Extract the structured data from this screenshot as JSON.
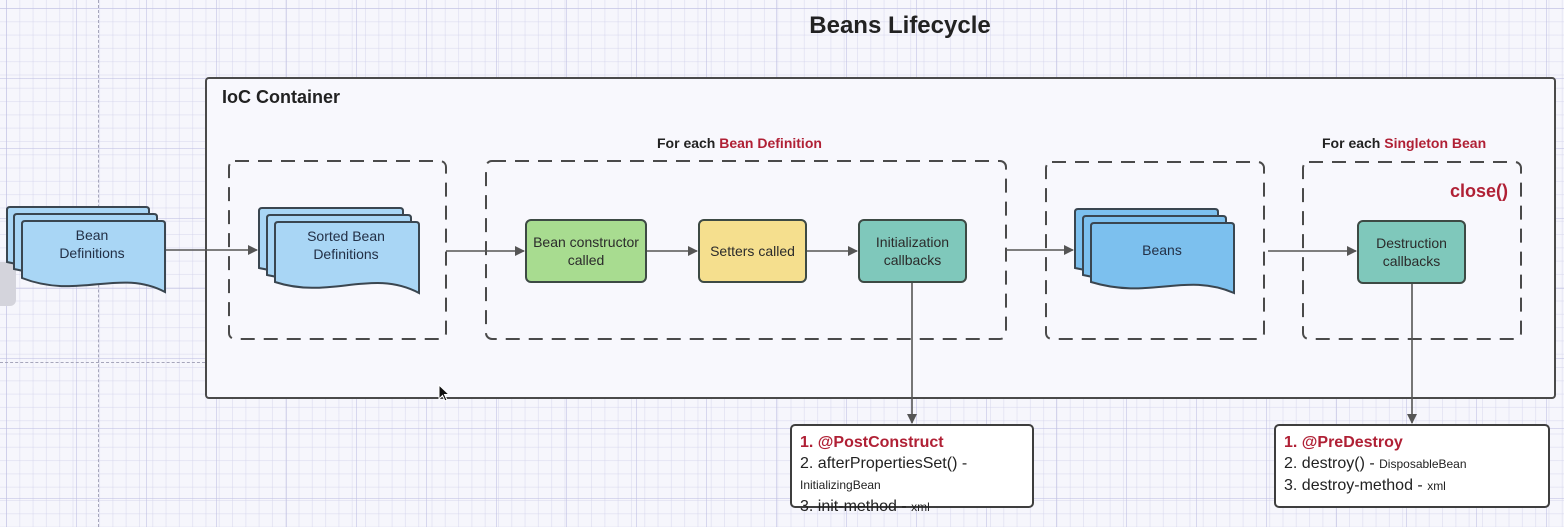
{
  "title": "Beans Lifecycle",
  "container": {
    "label": "IoC Container"
  },
  "sections": {
    "bean_definition_loop": {
      "prefix": "For each",
      "accent": "Bean Definition"
    },
    "singleton_loop": {
      "prefix": "For each",
      "accent": "Singleton Bean"
    },
    "close_label": "close()"
  },
  "nodes": {
    "bean_definitions": "Bean\nDefinitions",
    "sorted_bean_definitions": "Sorted Bean\nDefinitions",
    "bean_constructor": "Bean constructor\ncalled",
    "setters": "Setters called",
    "init_callbacks": "Initialization\ncallbacks",
    "beans": "Beans",
    "destruction_callbacks": "Destruction\ncallbacks"
  },
  "init_callbacks_list": [
    {
      "num": "1.",
      "text": "@PostConstruct",
      "note": ""
    },
    {
      "num": "2.",
      "text": "afterPropertiesSet()",
      "note": " - ",
      "small": "InitializingBean"
    },
    {
      "num": "3.",
      "text": "init-method",
      "note": " - ",
      "small": "xml"
    }
  ],
  "destroy_callbacks_list": [
    {
      "num": "1.",
      "text": "@PreDestroy",
      "note": ""
    },
    {
      "num": "2.",
      "text": "destroy()",
      "note": " - ",
      "small": "DisposableBean"
    },
    {
      "num": "3.",
      "text": "destroy-method",
      "note": " - ",
      "small": "xml"
    }
  ],
  "colors": {
    "accent": "#b02035",
    "doc_light": "#a9d6f5",
    "doc_mid": "#7cc0ee",
    "green": "#a8dc90",
    "yellow": "#f5df8e",
    "teal": "#7fc8bb"
  }
}
